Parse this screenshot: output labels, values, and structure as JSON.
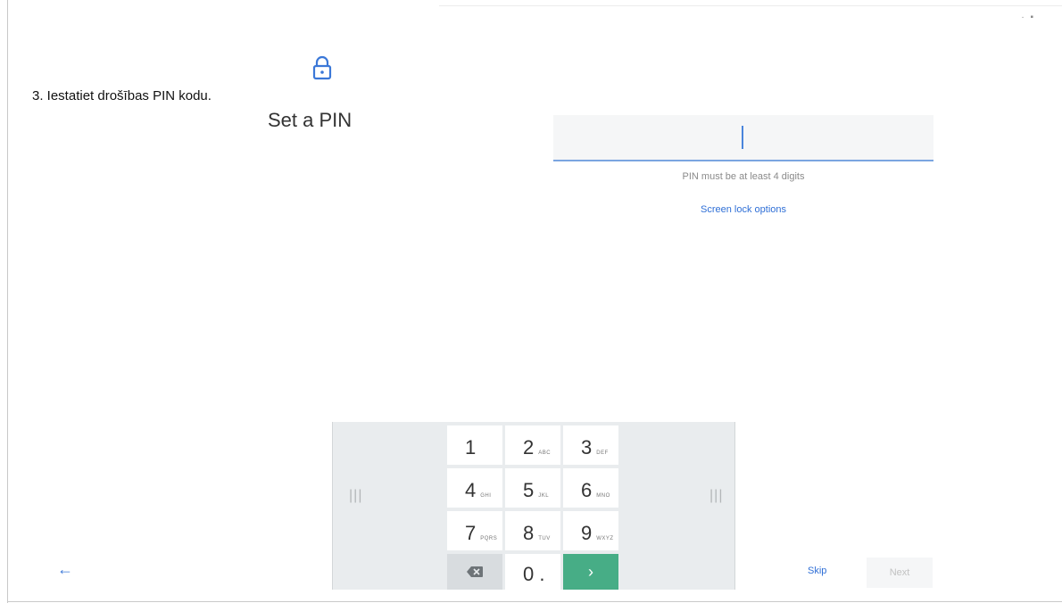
{
  "caption": "3. Iestatiet drošības PIN kodu.",
  "title": "Set a PIN",
  "status": "· ▪",
  "pin": {
    "value": "",
    "hint": "PIN must be at least 4 digits",
    "lock_options_link": "Screen lock options"
  },
  "keyboard": {
    "grip": "|||",
    "keys": [
      {
        "digit": "1",
        "letters": ""
      },
      {
        "digit": "2",
        "letters": "ABC"
      },
      {
        "digit": "3",
        "letters": "DEF"
      },
      {
        "digit": "4",
        "letters": "GHI"
      },
      {
        "digit": "5",
        "letters": "JKL"
      },
      {
        "digit": "6",
        "letters": "MNO"
      },
      {
        "digit": "7",
        "letters": "PQRS"
      },
      {
        "digit": "8",
        "letters": "TUV"
      },
      {
        "digit": "9",
        "letters": "WXYZ"
      }
    ],
    "zero_key": "0 .",
    "enter_key": "›"
  },
  "nav": {
    "back": "←",
    "skip": "Skip",
    "next": "Next"
  },
  "colors": {
    "accent": "#2f6fd6",
    "enter_key": "#47ad86",
    "input_underline": "#7aa5e0"
  },
  "icons": {
    "lock": "lock-icon",
    "delete": "backspace-icon",
    "enter": "chevron-right-icon",
    "back": "arrow-left-icon"
  }
}
